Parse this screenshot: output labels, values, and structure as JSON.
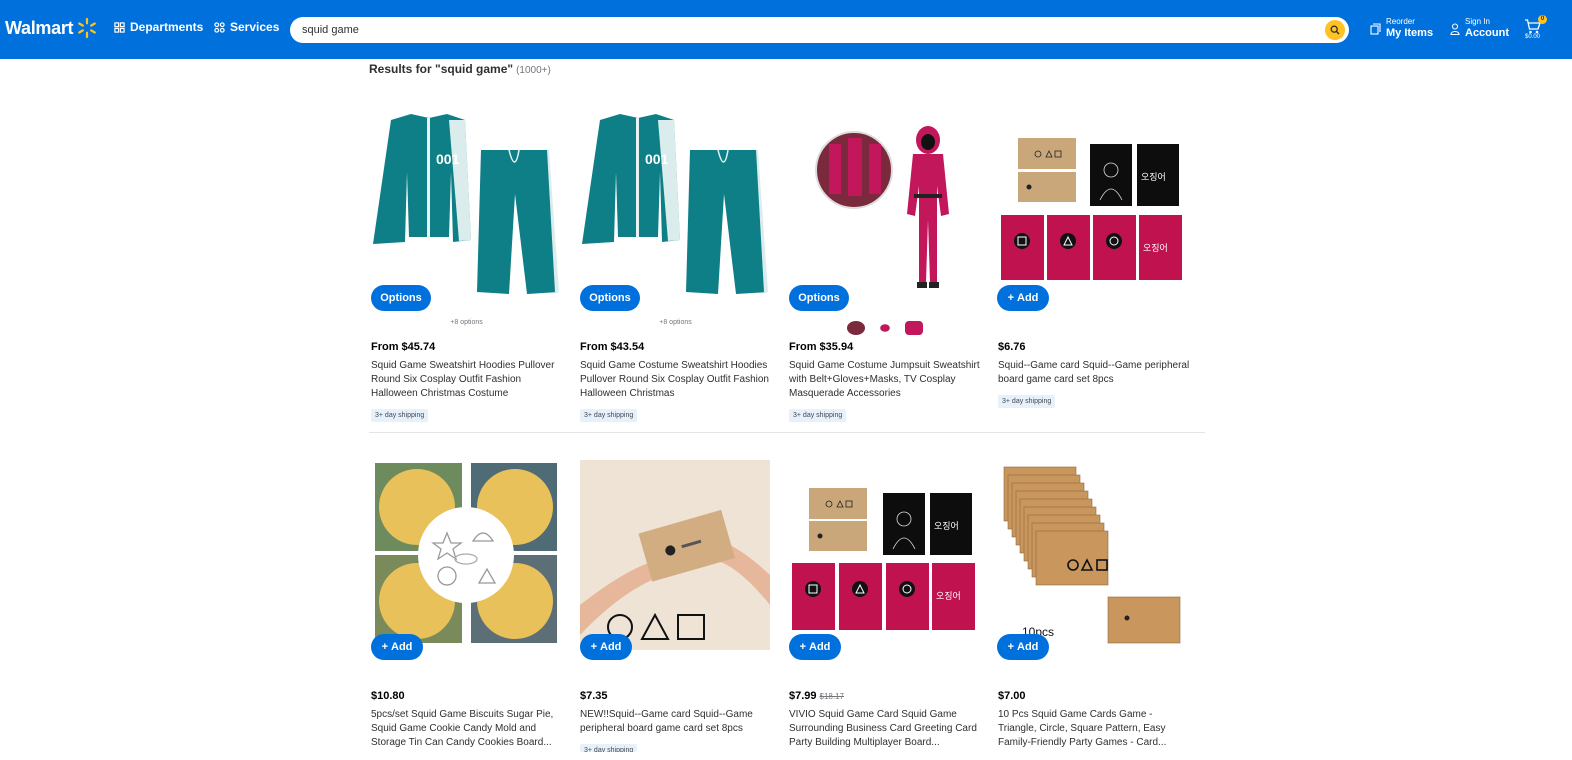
{
  "header": {
    "brand": "Walmart",
    "departments_label": "Departments",
    "services_label": "Services",
    "search_value": "squid game",
    "reorder_small": "Reorder",
    "reorder_big": "My Items",
    "signin_small": "Sign In",
    "signin_big": "Account",
    "cart_count": "0",
    "cart_total": "$0.00"
  },
  "results": {
    "prefix": "Results for \"squid game\"",
    "count": "(1000+)"
  },
  "products": [
    {
      "price": "From $45.74",
      "title": "Squid Game Sweatshirt Hoodies Pullover Round Six Cosplay Outfit Fashion Halloween Christmas Costume",
      "cta": "Options",
      "options_count": "+8 options",
      "shipping": "3+ day shipping"
    },
    {
      "price": "From $43.54",
      "title": "Squid Game Costume Sweatshirt Hoodies Pullover Round Six Cosplay Outfit Fashion Halloween Christmas",
      "cta": "Options",
      "options_count": "+8 options",
      "shipping": "3+ day shipping"
    },
    {
      "price": "From $35.94",
      "title": "Squid Game Costume Jumpsuit Sweatshirt with Belt+Gloves+Masks, TV Cosplay Masquerade Accessories",
      "cta": "Options",
      "shipping": "3+ day shipping"
    },
    {
      "price": "$6.76",
      "title": "Squid--Game card Squid--Game peripheral board game card set 8pcs",
      "cta": "Add",
      "shipping": "3+ day shipping"
    },
    {
      "price": "$10.80",
      "title": "5pcs/set Squid Game Biscuits Sugar Pie, Squid Game Cookie Candy Mold and Storage Tin Can Candy Cookies Board...",
      "cta": "Add"
    },
    {
      "price": "$7.35",
      "title": "NEW!!Squid--Game card Squid--Game peripheral board game card set 8pcs",
      "cta": "Add",
      "shipping": "3+ day shipping"
    },
    {
      "price": "$7.99",
      "was_price": "$18.17",
      "title": "VIVIO Squid Game Card Squid Game Surrounding Business Card Greeting Card Party Building Multiplayer Board...",
      "cta": "Add"
    },
    {
      "price": "$7.00",
      "title": "10 Pcs Squid Game Cards Game - Triangle, Circle, Square Pattern, Easy Family-Friendly Party Games - Card...",
      "cta": "Add",
      "image_caption": "10pcs"
    }
  ],
  "colors": {
    "brand_blue": "#0071dc",
    "spark_yellow": "#ffc220",
    "costume_teal": "#0e7f86",
    "guard_pink": "#c2185b",
    "card_kraft": "#c9a77a"
  }
}
